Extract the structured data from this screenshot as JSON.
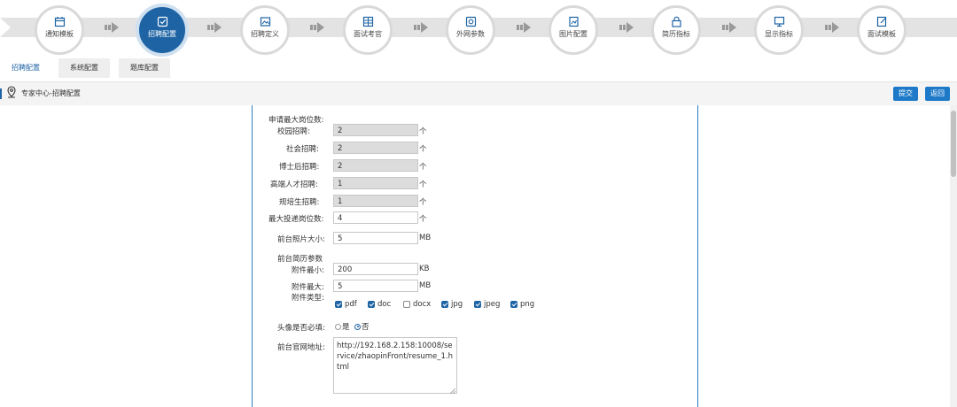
{
  "wizard": {
    "steps": [
      {
        "label": "通知模板",
        "icon": "calendar-icon"
      },
      {
        "label": "招聘配置",
        "icon": "edit-check-icon",
        "active": true
      },
      {
        "label": "招聘定义",
        "icon": "image-frame-icon"
      },
      {
        "label": "面试考官",
        "icon": "grid-icon"
      },
      {
        "label": "外网参数",
        "icon": "monitor-icon"
      },
      {
        "label": "图片配置",
        "icon": "picture-icon"
      },
      {
        "label": "简历指标",
        "icon": "lock-icon"
      },
      {
        "label": "显示指标",
        "icon": "screen-icon"
      },
      {
        "label": "面试模板",
        "icon": "doc-edit-icon"
      }
    ]
  },
  "tabs": [
    "招聘配置",
    "系统配置",
    "题库配置"
  ],
  "breadcrumb": "专家中心-招聘配置",
  "buttons": {
    "submit": "提交",
    "back": "返回"
  },
  "form": {
    "max_positions_title": "申请最大岗位数:",
    "campus": {
      "label": "校园招聘:",
      "value": "2",
      "unit": "个"
    },
    "social": {
      "label": "社会招聘:",
      "value": "2",
      "unit": "个"
    },
    "postdoc": {
      "label": "博士后招聘:",
      "value": "2",
      "unit": "个"
    },
    "talent": {
      "label": "高端人才招聘:",
      "value": "1",
      "unit": "个"
    },
    "trainee": {
      "label": "规培生招聘:",
      "value": "1",
      "unit": "个"
    },
    "max_submit": {
      "label": "最大投递岗位数:",
      "value": "4",
      "unit": "个"
    },
    "photo_size": {
      "label": "前台照片大小:",
      "value": "5",
      "unit": "MB"
    },
    "resume_params_title": "前台简历参数",
    "attach_min": {
      "label": "附件最小:",
      "value": "200",
      "unit": "KB"
    },
    "attach_max": {
      "label": "附件最大:",
      "value": "5",
      "unit": "MB"
    },
    "attach_type_label": "附件类型:",
    "attach_types": [
      {
        "label": "pdf",
        "checked": true
      },
      {
        "label": "doc",
        "checked": true
      },
      {
        "label": "docx",
        "checked": false
      },
      {
        "label": "jpg",
        "checked": true
      },
      {
        "label": "jpeg",
        "checked": true
      },
      {
        "label": "png",
        "checked": true
      }
    ],
    "avatar_required": {
      "label": "头像是否必填:",
      "yes": "是",
      "no": "否",
      "selected": "否"
    },
    "site_url": {
      "label": "前台官网地址:",
      "value": "http://192.168.2.158:10008/service/zhaopinFront/resume_1.html"
    }
  },
  "colors": {
    "primary": "#1e64a5",
    "button": "#1e7ac8",
    "track": "#e3e3e3"
  }
}
